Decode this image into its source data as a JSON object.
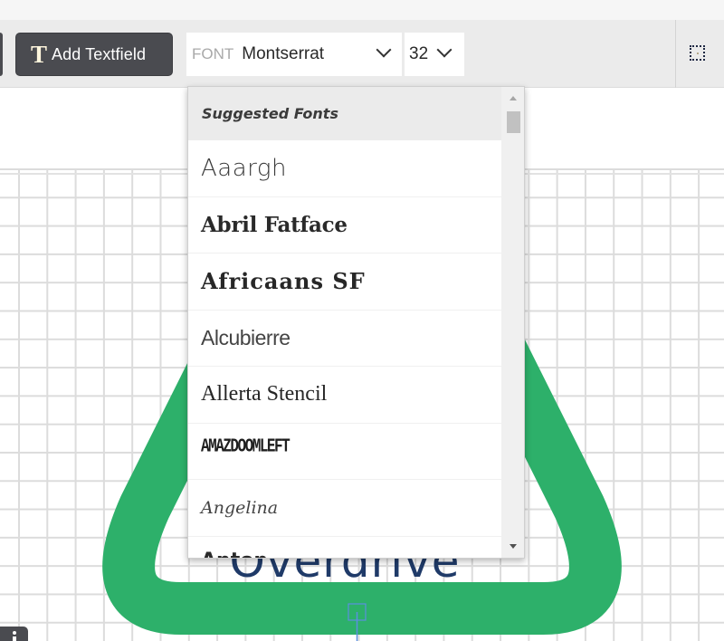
{
  "toolbar": {
    "add_textfield": {
      "icon": "text-T-icon",
      "label": "Add Textfield"
    },
    "font_select": {
      "prefix": "FONT",
      "value": "Montserrat",
      "icon": "chevron-down-icon"
    },
    "size_select": {
      "value": "32",
      "icon": "chevron-down-icon"
    },
    "select_tool": {
      "icon": "dotted-selection-icon"
    }
  },
  "font_dropdown": {
    "header": "Suggested Fonts",
    "items": [
      {
        "label": "Aaargh"
      },
      {
        "label": "Abril Fatface"
      },
      {
        "label": "Africaans SF"
      },
      {
        "label": "Alcubierre"
      },
      {
        "label": "Allerta Stencil"
      },
      {
        "label": "AMAZDOOMLEFT"
      },
      {
        "label": "Angelina"
      },
      {
        "label": "Anton"
      }
    ]
  },
  "canvas": {
    "text": "Overdrive",
    "text_color": "#1f3a68",
    "shape_color": "#2db06a",
    "handle_color": "#5b8fe0"
  },
  "info_button": {
    "icon": "info-icon"
  }
}
